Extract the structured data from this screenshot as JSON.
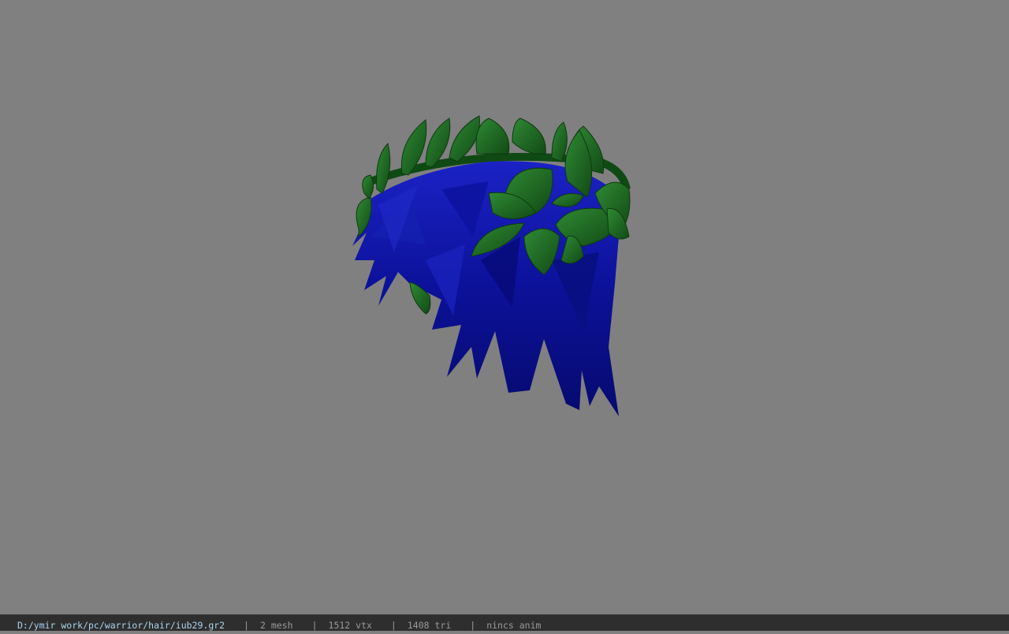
{
  "viewer": {
    "background_color": "#808080",
    "model": {
      "description_icon": "hair-mesh-with-leaf-wreath",
      "hair_color": "#0a0f9c",
      "leaf_color": "#1f6a22"
    }
  },
  "status_bar": {
    "file_path": "D:/ymir work/pc/warrior/hair/iub29.gr2",
    "separator": "|",
    "mesh_count": "2 mesh",
    "vertex_count": "1512 vtx",
    "triangle_count": "1408 tri",
    "anim_status": "nincs anim",
    "path_color": "#a9d4ee",
    "text_color": "#9a9a9a"
  }
}
